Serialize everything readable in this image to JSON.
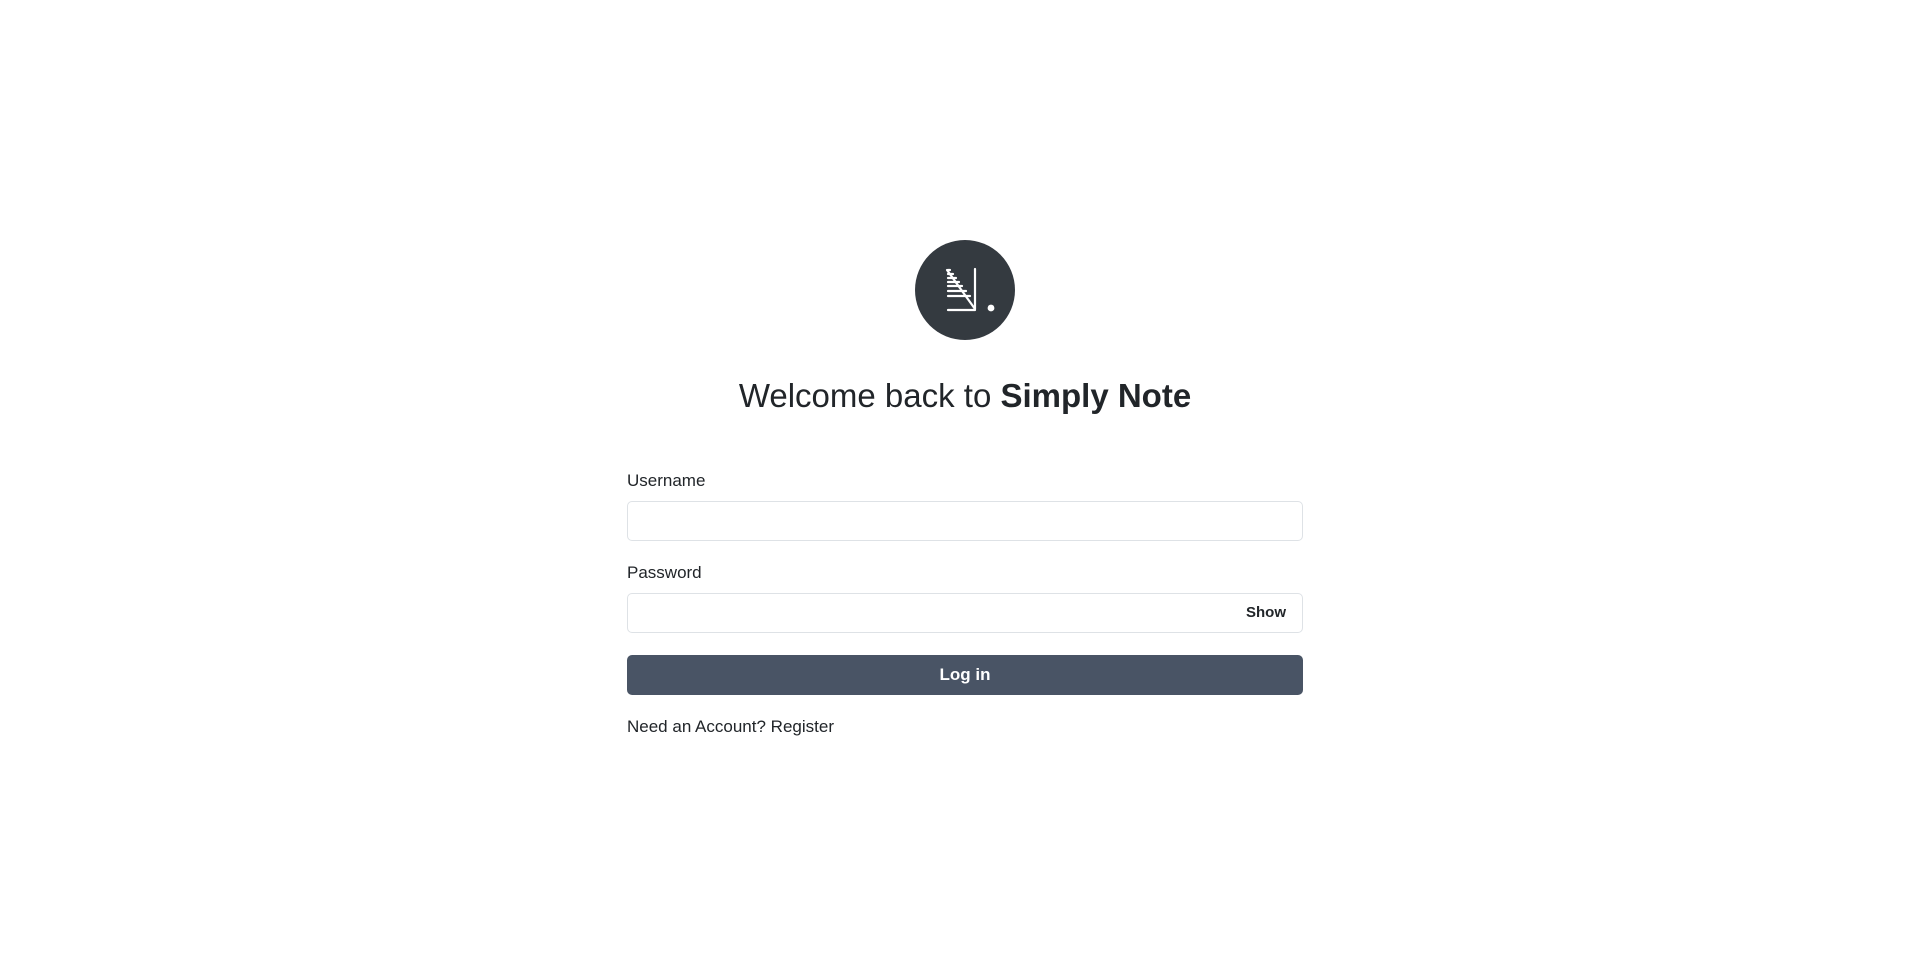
{
  "logo": {
    "icon": "simply-note-logo-icon",
    "background": "#343a40"
  },
  "heading": {
    "prefix": "Welcome back to ",
    "brand": "Simply Note"
  },
  "form": {
    "username_label": "Username",
    "username_value": "",
    "password_label": "Password",
    "password_value": "",
    "show_label": "Show",
    "submit_label": "Log in"
  },
  "register": {
    "prompt": "Need an Account? ",
    "link_label": "Register"
  },
  "colors": {
    "button": "#495465",
    "input_border": "#dee2e6",
    "text": "#212529"
  }
}
